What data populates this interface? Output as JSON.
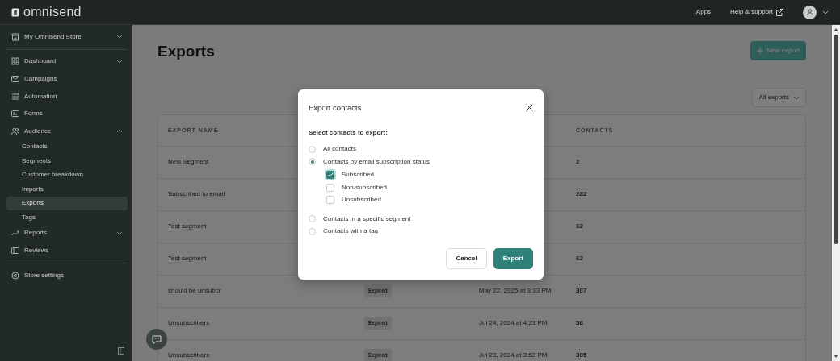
{
  "brand": "omnisend",
  "topnav": {
    "links": [
      {
        "label": "Apps",
        "external": false
      },
      {
        "label": "Help & support",
        "external": true
      }
    ]
  },
  "sidebar": {
    "store": "My Omnisend Store",
    "items": [
      {
        "label": "Dashboard",
        "expanded": false,
        "selected": false
      },
      {
        "label": "Campaigns",
        "selected": false
      },
      {
        "label": "Automation",
        "selected": false
      },
      {
        "label": "Forms",
        "selected": false
      },
      {
        "label": "Audience",
        "expanded": true,
        "selected": false,
        "children": [
          {
            "label": "Contacts",
            "selected": false
          },
          {
            "label": "Segments",
            "selected": false
          },
          {
            "label": "Customer breakdown",
            "selected": false
          },
          {
            "label": "Imports",
            "selected": false
          },
          {
            "label": "Exports",
            "selected": true
          },
          {
            "label": "Tags",
            "selected": false
          }
        ]
      },
      {
        "label": "Reports",
        "expanded": false,
        "selected": false
      },
      {
        "label": "Reviews",
        "selected": false
      }
    ],
    "settings": "Store settings"
  },
  "page": {
    "title": "Exports",
    "new_button": "New export",
    "filter": "All exports"
  },
  "table": {
    "column_headers": {
      "name": "EXPORT NAME",
      "contacts": "CONTACTS"
    },
    "rows": [
      {
        "name": "New Segment",
        "contacts": "2"
      },
      {
        "name": "Subscribed to email",
        "contacts": "282"
      },
      {
        "name": "Test segment",
        "contacts": "62"
      },
      {
        "name": "Test segment",
        "contacts": "62"
      },
      {
        "name": "should be unsubcr",
        "status": "Expired",
        "date": "May 22, 2025 at 3:33 PM",
        "contacts": "307"
      },
      {
        "name": "Unsubscribers",
        "status": "Expired",
        "date": "Jul 24, 2024 at 4:23 PM",
        "contacts": "58"
      },
      {
        "name": "Unsubscribers",
        "status": "Expired",
        "date": "Jul 23, 2024 at 3:52 PM",
        "contacts": "305"
      }
    ]
  },
  "modal": {
    "title": "Export contacts",
    "prompt": "Select contacts to export:",
    "options": [
      {
        "label": "All contacts",
        "selected": false
      },
      {
        "label": "Contacts by email subscription status",
        "selected": true,
        "children": [
          {
            "label": "Subscribed",
            "checked": true
          },
          {
            "label": "Non-subscribed",
            "checked": false
          },
          {
            "label": "Unsubscribed",
            "checked": false
          }
        ]
      },
      {
        "label": "Contacts in a specific segment",
        "selected": false
      },
      {
        "label": "Contacts with a tag",
        "selected": false
      }
    ],
    "buttons": {
      "cancel": "Cancel",
      "confirm": "Export"
    }
  }
}
